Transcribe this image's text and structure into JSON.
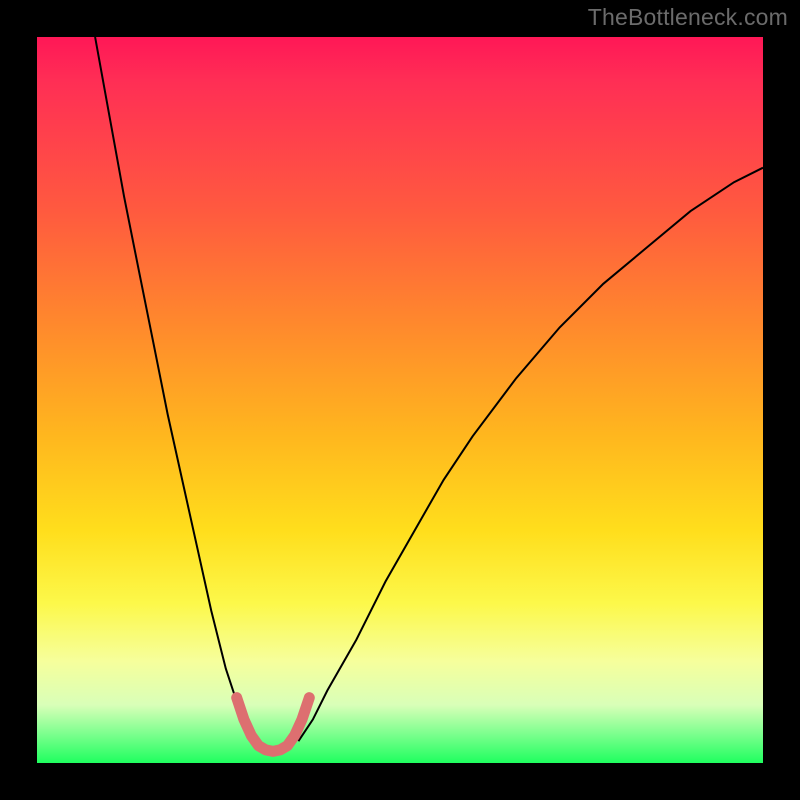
{
  "watermark": "TheBottleneck.com",
  "chart_data": {
    "type": "line",
    "title": "",
    "xlabel": "",
    "ylabel": "",
    "xlim": [
      0,
      100
    ],
    "ylim": [
      0,
      100
    ],
    "grid": false,
    "legend": false,
    "background_gradient": {
      "direction": "vertical",
      "stops": [
        {
          "pos": 0.0,
          "color": "#ff1756"
        },
        {
          "pos": 0.24,
          "color": "#ff5a3f"
        },
        {
          "pos": 0.55,
          "color": "#ffb71e"
        },
        {
          "pos": 0.78,
          "color": "#fcf84a"
        },
        {
          "pos": 0.92,
          "color": "#d9ffb8"
        },
        {
          "pos": 1.0,
          "color": "#1fff5f"
        }
      ]
    },
    "series": [
      {
        "name": "left-branch",
        "stroke": "#000000",
        "stroke_width": 2,
        "x": [
          8,
          10,
          12,
          14,
          16,
          18,
          20,
          22,
          24,
          25,
          26,
          27,
          28,
          29,
          30
        ],
        "y": [
          100,
          89,
          78,
          68,
          58,
          48,
          39,
          30,
          21,
          17,
          13,
          10,
          7,
          5,
          3
        ]
      },
      {
        "name": "right-branch",
        "stroke": "#000000",
        "stroke_width": 2,
        "x": [
          36,
          38,
          40,
          44,
          48,
          52,
          56,
          60,
          66,
          72,
          78,
          84,
          90,
          96,
          100
        ],
        "y": [
          3,
          6,
          10,
          17,
          25,
          32,
          39,
          45,
          53,
          60,
          66,
          71,
          76,
          80,
          82
        ]
      },
      {
        "name": "highlight-band",
        "stroke": "#dd6f70",
        "stroke_width": 11,
        "linecap": "round",
        "x": [
          27.5,
          28.5,
          29.5,
          30.5,
          31.5,
          32.5,
          33.5,
          34.5,
          35.5,
          36.5,
          37.5
        ],
        "y": [
          9.0,
          6.0,
          3.8,
          2.4,
          1.8,
          1.6,
          1.8,
          2.4,
          3.8,
          6.0,
          9.0
        ]
      }
    ],
    "minimum": {
      "x": 32.5,
      "y": 1.6
    }
  }
}
